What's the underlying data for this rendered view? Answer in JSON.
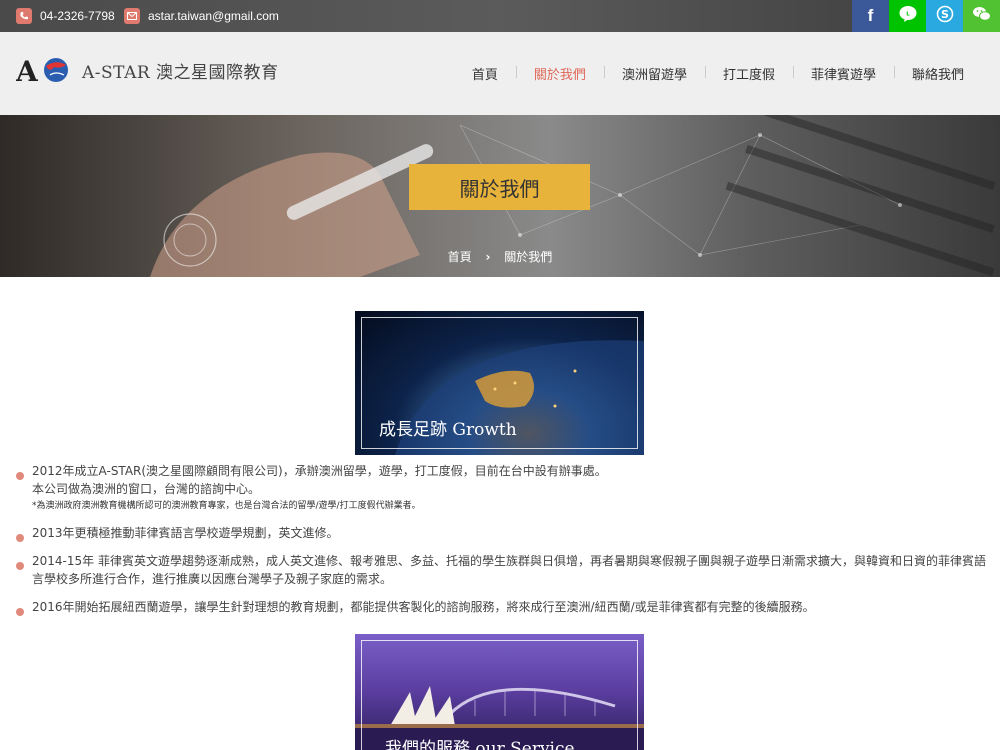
{
  "topbar": {
    "phone": "04-2326-7798",
    "email": "astar.taiwan@gmail.com",
    "socials": [
      {
        "name": "facebook",
        "glyph": "f",
        "color": "#3b5998"
      },
      {
        "name": "line",
        "glyph": "L",
        "color": "#00c300"
      },
      {
        "name": "skype",
        "glyph": "S",
        "color": "#2aa8e0"
      },
      {
        "name": "wechat",
        "glyph": "W",
        "color": "#51c332"
      }
    ]
  },
  "header": {
    "logo_text": "A-STAR 澳之星國際教育",
    "nav": [
      "首頁",
      "關於我們",
      "澳洲留遊學",
      "打工度假",
      "菲律賓遊學",
      "聯絡我們"
    ]
  },
  "hero": {
    "title": "關於我們",
    "breadcrumb": [
      "首頁",
      "關於我們"
    ]
  },
  "content": {
    "banner_caption": "成長足跡 Growth",
    "items": [
      {
        "lines": [
          "2012年成立A-STAR(澳之星國際顧問有限公司)，承辦澳洲留學，遊學，打工度假，目前在台中設有辦事處。",
          "本公司做為澳洲的窗口，台灣的諮詢中心。"
        ],
        "note": "*為澳洲政府澳洲教育機構所認可的澳洲教育專家，也是台灣合法的留學/遊學/打工度假代辦業者。"
      },
      {
        "lines": [
          "2013年更積極推動菲律賓語言學校遊學規劃，英文進修。"
        ],
        "note": ""
      },
      {
        "lines": [
          "2014-15年 菲律賓英文遊學趨勢逐漸成熟，成人英文進修、報考雅思、多益、托福的學生族群與日俱增，再者暑期與寒假親子團與親子遊學日漸需求擴大，與韓資和日資的菲律賓語言學校多所進行合作，進行推廣以因應台灣學子及親子家庭的需求。"
        ],
        "note": ""
      },
      {
        "lines": [
          "2016年開始拓展紐西蘭遊學，讓學生針對理想的教育規劃，都能提供客製化的諮詢服務，將來成行至澳洲/紐西蘭/或是菲律賓都有完整的後續服務。"
        ],
        "note": ""
      }
    ],
    "banner2_caption": "我們的服務 our Service"
  }
}
